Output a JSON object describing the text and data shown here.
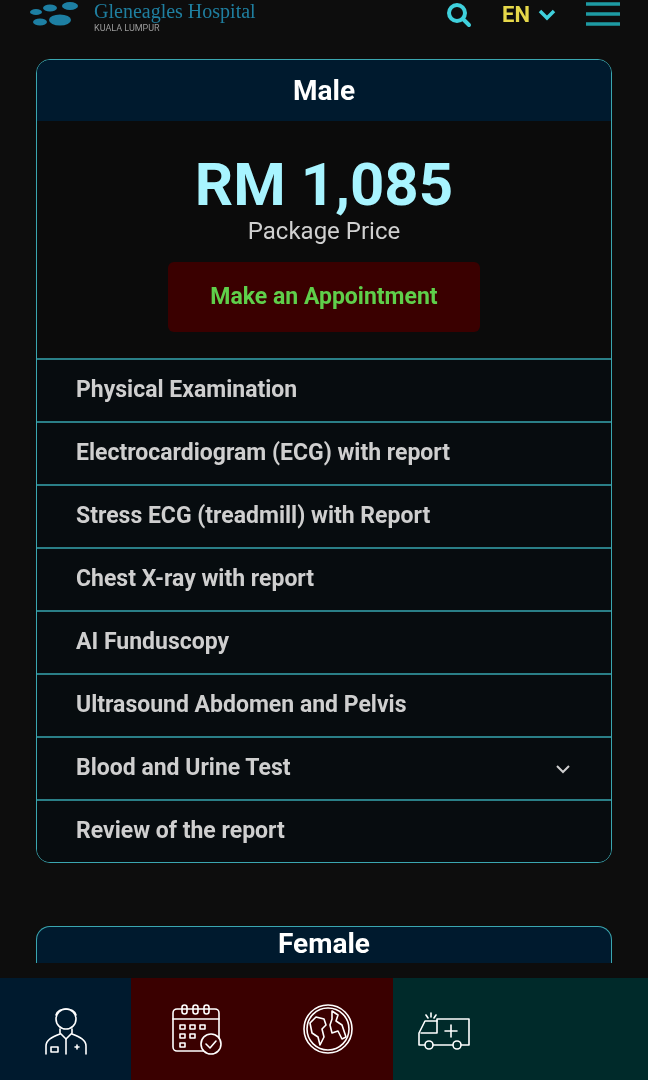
{
  "header": {
    "brand": "Gleneagles Hospital",
    "location": "KUALA LUMPUR",
    "language": "EN"
  },
  "packages": [
    {
      "title": "Male",
      "price": "RM 1,085",
      "price_label": "Package Price",
      "button": "Make an Appointment",
      "items": [
        {
          "label": "Physical Examination",
          "kind": "plain"
        },
        {
          "label": "Electrocardiogram (ECG) with report",
          "kind": "plain"
        },
        {
          "label": "Stress ECG (treadmill) with Report",
          "kind": "plain"
        },
        {
          "label": "Chest X-ray with report",
          "kind": "plain"
        },
        {
          "label": "AI Funduscopy",
          "kind": "plain"
        },
        {
          "label": "Ultrasound Abdomen and Pelvis",
          "kind": "plain"
        },
        {
          "label": "Blood and Urine Test",
          "kind": "expandable"
        },
        {
          "label": "Review of the report",
          "kind": "plain"
        }
      ]
    },
    {
      "title": "Female"
    }
  ],
  "bottom_nav": [
    {
      "kind": "doctor",
      "color": "#001a2e"
    },
    {
      "kind": "calendar",
      "color": "#3a0000"
    },
    {
      "kind": "globe",
      "color": "#3a0000"
    },
    {
      "kind": "ambulance",
      "color": "#002a2a"
    }
  ]
}
